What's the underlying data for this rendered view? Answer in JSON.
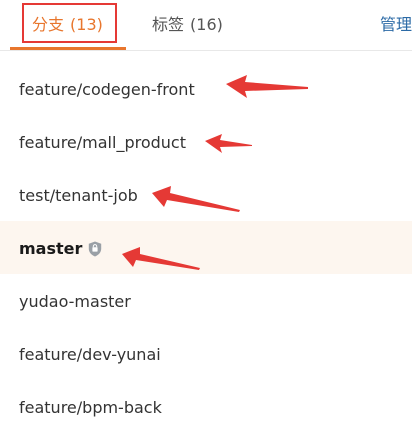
{
  "tabs": {
    "branches": {
      "label": "分支",
      "count": "(13)"
    },
    "tags": {
      "label": "标签",
      "count": "(16)"
    },
    "manage": "管理"
  },
  "branches": [
    {
      "name": "feature/codegen-front"
    },
    {
      "name": "feature/mall_product"
    },
    {
      "name": "test/tenant-job"
    },
    {
      "name": "master",
      "default": true,
      "icon": "shield-icon"
    },
    {
      "name": "yudao-master"
    },
    {
      "name": "feature/dev-yunai"
    },
    {
      "name": "feature/bpm-back"
    }
  ],
  "colors": {
    "active_tab": "#e8762d",
    "link": "#2b6aa6",
    "annotation": "#e53935",
    "default_row_bg": "#fdf6ef",
    "shield": "#9aa0a6"
  }
}
